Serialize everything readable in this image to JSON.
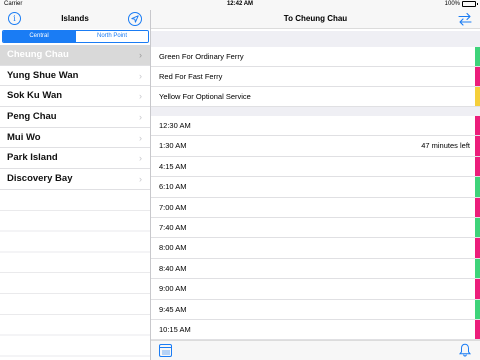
{
  "status": {
    "carrier": "Carrier",
    "time": "12:42 AM",
    "battery": "100%"
  },
  "left_panel": {
    "title": "Islands",
    "segments": [
      "Central",
      "North Point"
    ],
    "selected_segment": "Central",
    "islands": [
      "Cheung Chau",
      "Yung Shue Wan",
      "Sok Ku Wan",
      "Peng Chau",
      "Mui Wo",
      "Park Island",
      "Discovery Bay"
    ],
    "selected_island": "Cheung Chau"
  },
  "right_panel": {
    "title": "To Cheung Chau",
    "legend": [
      {
        "label": "Green For Ordinary Ferry",
        "color": "#3ed37a"
      },
      {
        "label": "Red For Fast Ferry",
        "color": "#ec1e7b"
      },
      {
        "label": "Yellow For Optional Service",
        "color": "#f5cf3a"
      }
    ],
    "departures": [
      {
        "time": "12:30 AM",
        "color": "#ec1e7b",
        "note": ""
      },
      {
        "time": "1:30 AM",
        "color": "#ec1e7b",
        "note": "47 minutes left"
      },
      {
        "time": "4:15 AM",
        "color": "#ec1e7b",
        "note": ""
      },
      {
        "time": "6:10 AM",
        "color": "#3ed37a",
        "note": ""
      },
      {
        "time": "7:00 AM",
        "color": "#ec1e7b",
        "note": ""
      },
      {
        "time": "7:40 AM",
        "color": "#3ed37a",
        "note": ""
      },
      {
        "time": "8:00 AM",
        "color": "#ec1e7b",
        "note": ""
      },
      {
        "time": "8:40 AM",
        "color": "#3ed37a",
        "note": ""
      },
      {
        "time": "9:00 AM",
        "color": "#ec1e7b",
        "note": ""
      },
      {
        "time": "9:45 AM",
        "color": "#3ed37a",
        "note": ""
      },
      {
        "time": "10:15 AM",
        "color": "#ec1e7b",
        "note": ""
      }
    ]
  },
  "colors": {
    "accent": "#1a7cf4"
  }
}
